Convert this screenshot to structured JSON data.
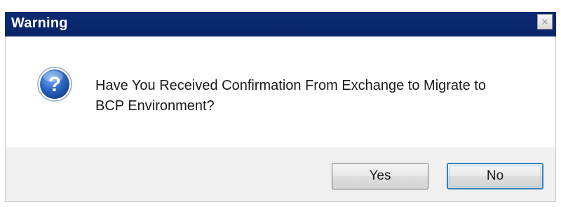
{
  "window": {
    "title": "Warning"
  },
  "message": {
    "line1": "Have You Received Confirmation From Exchange to Migrate to",
    "line2": "BCP Environment?"
  },
  "icons": {
    "close": "close-icon",
    "question": "question-icon"
  },
  "buttons": {
    "yes_label": "Yes",
    "no_label": "No",
    "default": "No"
  },
  "colors": {
    "titlebar": "#0c2b73",
    "footer": "#f0f0f0",
    "icon_blue": "#1f5fb8"
  }
}
